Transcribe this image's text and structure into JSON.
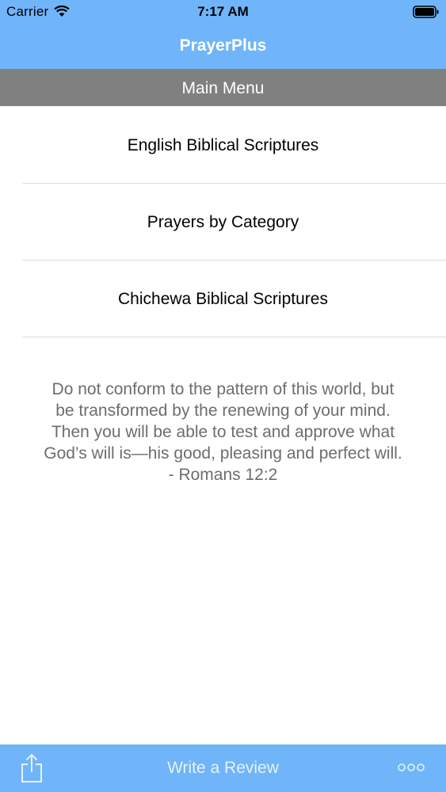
{
  "status_bar": {
    "carrier": "Carrier",
    "time": "7:17 AM"
  },
  "nav": {
    "title": "PrayerPlus"
  },
  "section": {
    "title": "Main Menu"
  },
  "menu": {
    "items": [
      {
        "label": "English Biblical Scriptures"
      },
      {
        "label": "Prayers by Category"
      },
      {
        "label": "Chichewa Biblical Scriptures"
      }
    ]
  },
  "verse": {
    "text": "Do not conform to the pattern of this world, but\nbe transformed by the renewing of your mind.\nThen you will be able to test and approve what\nGod’s will is—his good, pleasing and perfect will.\n- Romans 12:2"
  },
  "toolbar": {
    "review_label": "Write a Review"
  },
  "colors": {
    "bar": "#70b5fa",
    "section": "#808080",
    "verse_text": "#6d6d6d"
  },
  "icons": {
    "share": "share-icon",
    "more": "more-icon",
    "wifi": "wifi-icon",
    "battery": "battery-icon"
  }
}
